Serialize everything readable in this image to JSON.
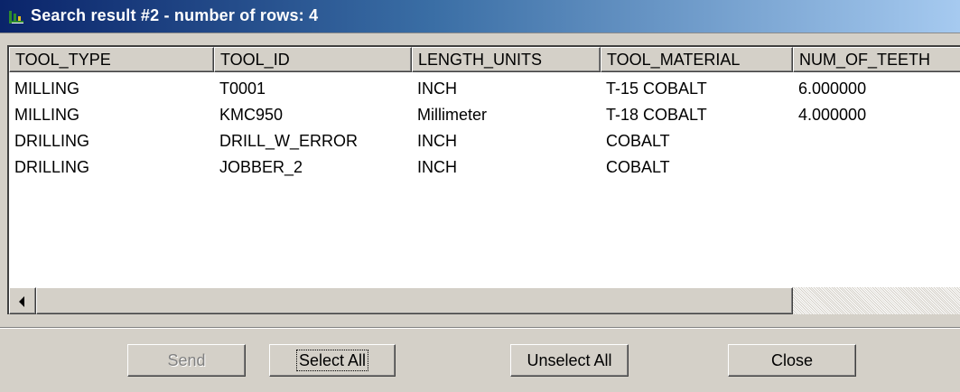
{
  "window": {
    "title": "Search result #2 - number of rows:  4",
    "icon": "table-result-icon"
  },
  "table": {
    "columns": [
      "TOOL_TYPE",
      "TOOL_ID",
      "LENGTH_UNITS",
      "TOOL_MATERIAL",
      "NUM_OF_TEETH"
    ],
    "rows": [
      [
        "MILLING",
        "T0001",
        "INCH",
        "T-15 COBALT",
        "6.000000"
      ],
      [
        "MILLING",
        "KMC950",
        "Millimeter",
        "T-18 COBALT",
        "4.000000"
      ],
      [
        "DRILLING",
        "DRILL_W_ERROR",
        "INCH",
        "COBALT",
        ""
      ],
      [
        "DRILLING",
        "JOBBER_2",
        "INCH",
        "COBALT",
        ""
      ]
    ]
  },
  "scrollbar": {
    "left_arrow_icon": "arrow-left-icon"
  },
  "buttons": {
    "send": "Send",
    "select_all": "Select All",
    "unselect_all": "Unselect All",
    "close": "Close"
  },
  "colors": {
    "title_gradient_start": "#0a246a",
    "title_gradient_end": "#a6caf0",
    "face": "#d4d0c8",
    "grid_background": "#ffffff"
  }
}
